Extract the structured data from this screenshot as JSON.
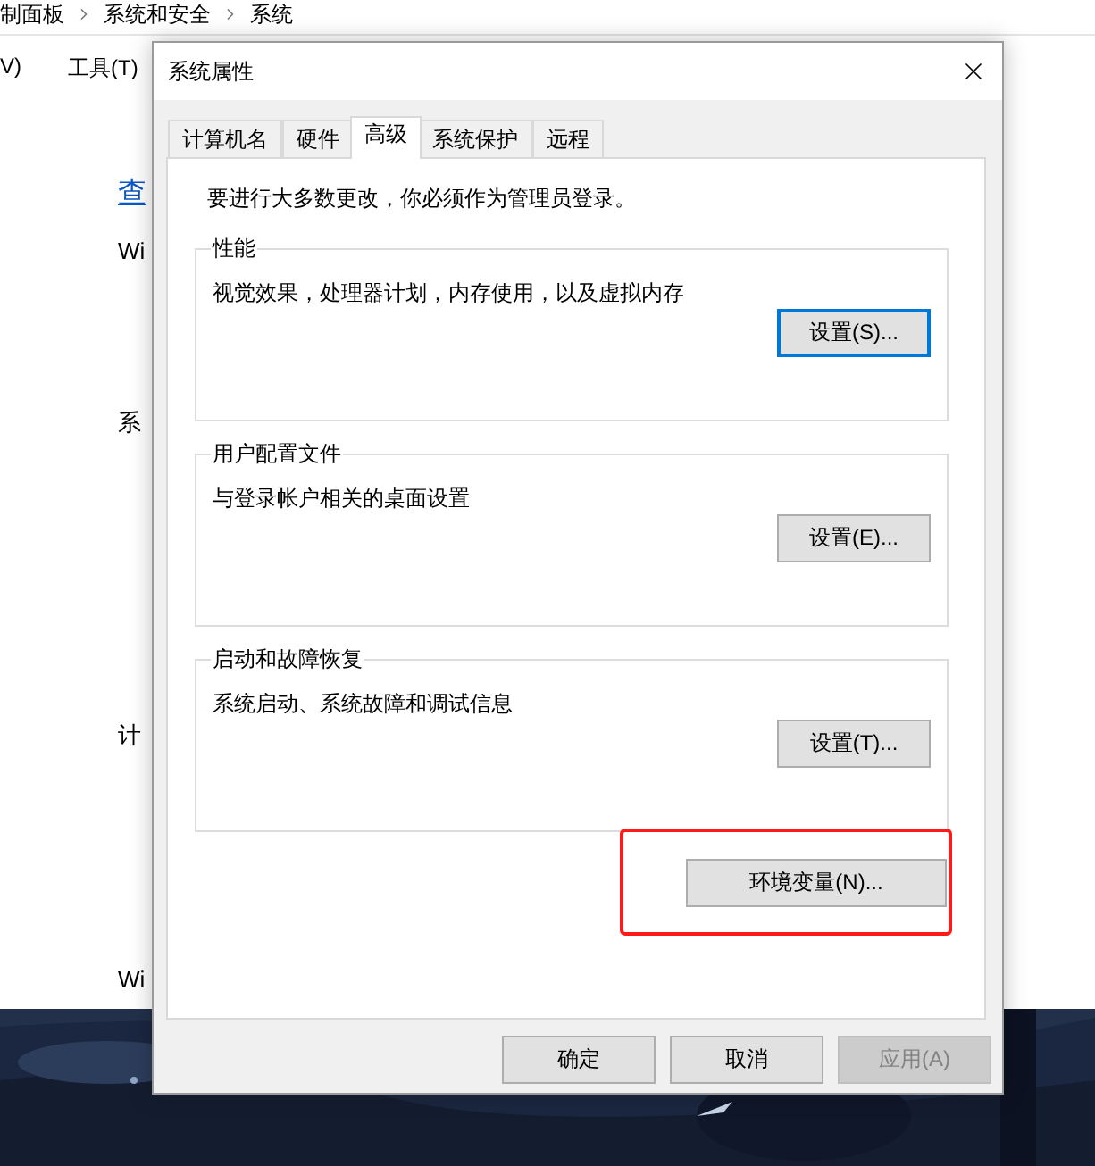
{
  "background_window": {
    "breadcrumb": [
      "制面板",
      "系统和安全",
      "系统"
    ],
    "menu": [
      "V)",
      "工具(T)"
    ],
    "content": [
      {
        "text": "查",
        "kind": "link"
      },
      {
        "text": "Wi",
        "kind": "text"
      },
      {
        "text": "系",
        "kind": "text"
      },
      {
        "text": "计",
        "kind": "text"
      },
      {
        "text": "Wi",
        "kind": "text"
      }
    ]
  },
  "dialog": {
    "title": "系统属性",
    "tabs": [
      {
        "label": "计算机名",
        "selected": false
      },
      {
        "label": "硬件",
        "selected": false
      },
      {
        "label": "高级",
        "selected": true
      },
      {
        "label": "系统保护",
        "selected": false
      },
      {
        "label": "远程",
        "selected": false
      }
    ],
    "notice": "要进行大多数更改，你必须作为管理员登录。",
    "groups": [
      {
        "title": "性能",
        "description": "视觉效果，处理器计划，内存使用，以及虚拟内存",
        "button": "设置(S)...",
        "focused": true
      },
      {
        "title": "用户配置文件",
        "description": "与登录帐户相关的桌面设置",
        "button": "设置(E)...",
        "focused": false
      },
      {
        "title": "启动和故障恢复",
        "description": "系统启动、系统故障和调试信息",
        "button": "设置(T)...",
        "focused": false
      }
    ],
    "env_button": {
      "label": "环境变量(N)...",
      "highlighted": true
    },
    "footer_buttons": [
      {
        "label": "确定",
        "disabled": false
      },
      {
        "label": "取消",
        "disabled": false
      },
      {
        "label": "应用(A)",
        "disabled": true
      }
    ]
  }
}
